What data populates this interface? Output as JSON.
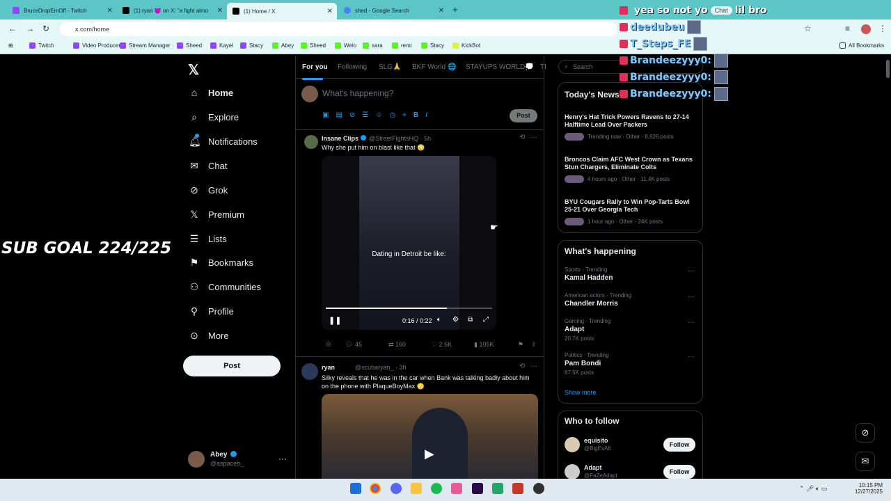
{
  "browser": {
    "tabs": [
      {
        "label": "BruceDropEmOff - Twitch",
        "color": "#9146ff"
      },
      {
        "label": "(1) ryan 😈 on X: \"a fight almo",
        "color": "#000000"
      },
      {
        "label": "(1) Home / X",
        "color": "#000000"
      },
      {
        "label": "shed - Google Search",
        "color": "#4285f4"
      }
    ],
    "url": "x.com/home",
    "bookmarks": [
      {
        "label": "Twitch",
        "color": "#9146ff"
      },
      {
        "label": "Video Producer",
        "color": "#9146ff"
      },
      {
        "label": "Stream Manager",
        "color": "#9146ff"
      },
      {
        "label": "Sheed",
        "color": "#9146ff"
      },
      {
        "label": "Kayel",
        "color": "#9146ff"
      },
      {
        "label": "Stacy",
        "color": "#9146ff"
      },
      {
        "label": "Abey",
        "color": "#53fc18"
      },
      {
        "label": "Sheed",
        "color": "#53fc18"
      },
      {
        "label": "Welo",
        "color": "#53fc18"
      },
      {
        "label": "sara",
        "color": "#53fc18"
      },
      {
        "label": "remi",
        "color": "#53fc18"
      },
      {
        "label": "Stacy",
        "color": "#53fc18"
      },
      {
        "label": "KickBot",
        "color": "#d9f540"
      }
    ],
    "all_bookmarks": "All Bookmarks"
  },
  "overlay": {
    "sub_goal": "SUB GOAL 224/225",
    "chat": [
      {
        "name": "",
        "msg": "yea so not yo",
        "tail": "lil bro"
      },
      {
        "name": "deedubeu",
        "msg": ""
      },
      {
        "name": "T_Steps_FE",
        "msg": ""
      },
      {
        "name": "Brandeezyyy0:",
        "msg": ""
      },
      {
        "name": "Brandeezyyy0:",
        "msg": ""
      },
      {
        "name": "Brandeezyyy0:",
        "msg": ""
      }
    ],
    "chat_button": "Chat"
  },
  "sidebar": {
    "items": [
      {
        "label": "Home",
        "icon": "home-icon"
      },
      {
        "label": "Explore",
        "icon": "search-icon"
      },
      {
        "label": "Notifications",
        "icon": "bell-icon"
      },
      {
        "label": "Chat",
        "icon": "mail-icon"
      },
      {
        "label": "Grok",
        "icon": "grok-icon"
      },
      {
        "label": "Premium",
        "icon": "x-logo-icon"
      },
      {
        "label": "Lists",
        "icon": "list-icon"
      },
      {
        "label": "Bookmarks",
        "icon": "bookmark-icon"
      },
      {
        "label": "Communities",
        "icon": "people-icon"
      },
      {
        "label": "Profile",
        "icon": "person-icon"
      },
      {
        "label": "More",
        "icon": "more-icon"
      }
    ],
    "post_label": "Post",
    "account": {
      "name": "Abey",
      "handle": "@aspaceb_"
    }
  },
  "feed": {
    "tabs": [
      "For you",
      "Following",
      "SLG🙏",
      "BKF World 🌐",
      "STAYUPS WORLD💭",
      "TI"
    ],
    "composer_placeholder": "What's happening?",
    "composer_post": "Post",
    "tweets": [
      {
        "author": "Insane Clips",
        "handle": "@StreetFightsHQ · 5h",
        "text": "Why she put him on blast like that 😳",
        "video_caption": "Dating in Detroit be like:",
        "time": "0:16 / 0:22",
        "progress": 0.73,
        "replies": "45",
        "reposts": "160",
        "likes": "2.6K",
        "views": "105K"
      },
      {
        "author": "ryan",
        "handle": "@scubaryan_ · 3h",
        "text": "Silky reveals that he was in the car when Bank was talking badly about him on the phone with PlaqueBoyMax 😳"
      }
    ]
  },
  "right": {
    "search_placeholder": "Search",
    "news_title": "Today's News",
    "news": [
      {
        "headline": "Henry's Hat Trick Powers Ravens to 27-14 Halftime Lead Over Packers",
        "meta": "Trending now · Other · 8,626 posts"
      },
      {
        "headline": "Broncos Claim AFC West Crown as Texans Stun Chargers, Eliminate Colts",
        "meta": "4 hours ago · Other · 11.4K posts"
      },
      {
        "headline": "BYU Cougars Rally to Win Pop-Tarts Bowl 25-21 Over Georgia Tech",
        "meta": "1 hour ago · Other · 24K posts"
      }
    ],
    "happening_title": "What's happening",
    "trends": [
      {
        "meta": "Sports · Trending",
        "name": "Kamal Hadden",
        "posts": ""
      },
      {
        "meta": "American actors · Trending",
        "name": "Chandler Morris",
        "posts": ""
      },
      {
        "meta": "Gaming · Trending",
        "name": "Adapt",
        "posts": "20.7K posts"
      },
      {
        "meta": "Politics · Trending",
        "name": "Pam Bondi",
        "posts": "87.5K posts"
      }
    ],
    "show_more": "Show more",
    "who_title": "Who to follow",
    "follow": [
      {
        "name": "equisito",
        "handle": "@BigExAlt",
        "btn": "Follow"
      },
      {
        "name": "Adapt",
        "handle": "@FaZeAdapt",
        "btn": "Follow"
      }
    ]
  },
  "taskbar": {
    "time": "10:15 PM",
    "date": "12/27/2025"
  }
}
